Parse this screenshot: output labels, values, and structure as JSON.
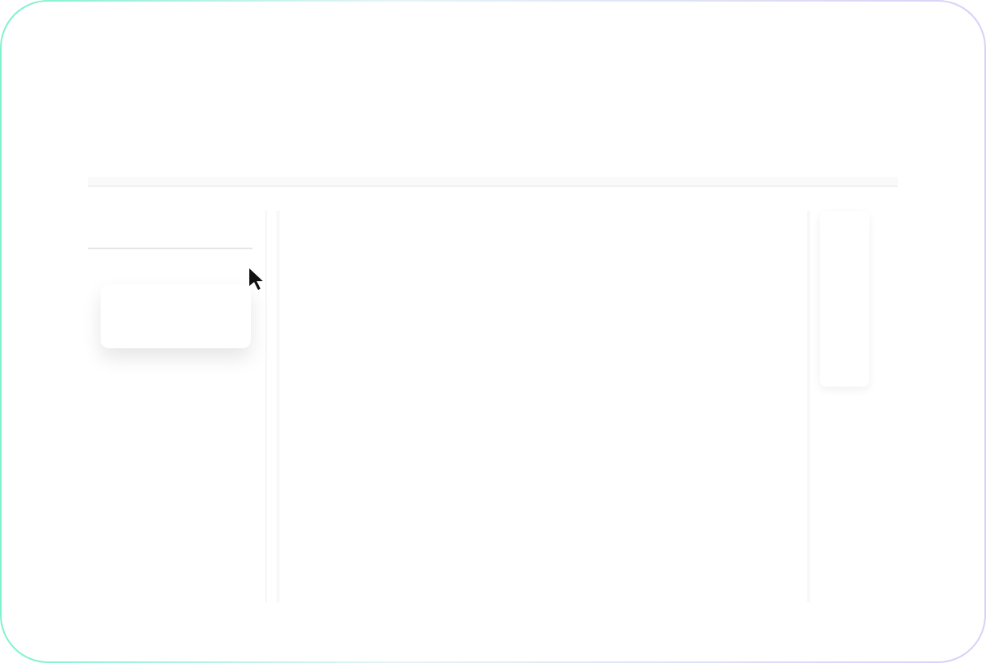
{
  "frame": {
    "kind": "wireframe"
  },
  "cursor": {
    "kind": "arrow"
  }
}
